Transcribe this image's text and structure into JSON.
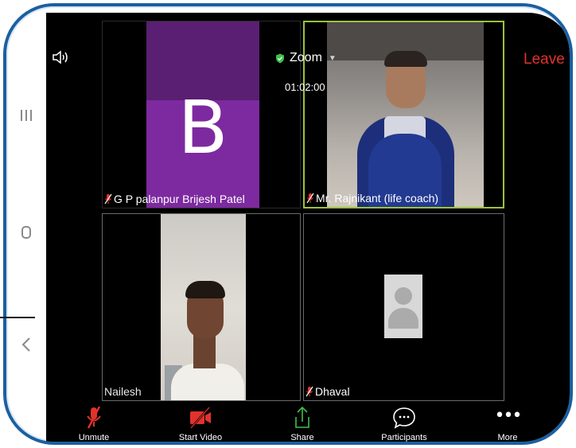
{
  "app": {
    "brand": "Zoom",
    "timer": "01:02:00",
    "leave_label": "Leave"
  },
  "colors": {
    "leave": "#e0332b",
    "active_speaker_border": "#9bc33a",
    "frame": "#1b5fa0",
    "avatar_purple": "#7d2aa0",
    "muted_red": "#e0332b",
    "share_green": "#3fbf4b"
  },
  "participants": [
    {
      "name": "G P palanpur Brijesh Patel",
      "avatar_letter": "B",
      "muted": true,
      "video": false
    },
    {
      "name": "Mr. Rajnikant (life coach)",
      "muted": true,
      "video": true,
      "active_speaker": true
    },
    {
      "name": "Nailesh",
      "muted": false,
      "video": true
    },
    {
      "name": "Dhaval",
      "muted": true,
      "video": false
    }
  ],
  "toolbar": {
    "unmute_label": "Unmute",
    "start_video_label": "Start Video",
    "share_label": "Share",
    "participants_label": "Participants",
    "more_label": "More"
  },
  "icons": {
    "speaker": "speaker-icon",
    "shield": "shield-check-icon",
    "unmute": "mic-muted-icon",
    "video": "video-off-icon",
    "share": "share-arrow-icon",
    "participants": "chat-bubble-icon",
    "more": "ellipsis-icon"
  }
}
